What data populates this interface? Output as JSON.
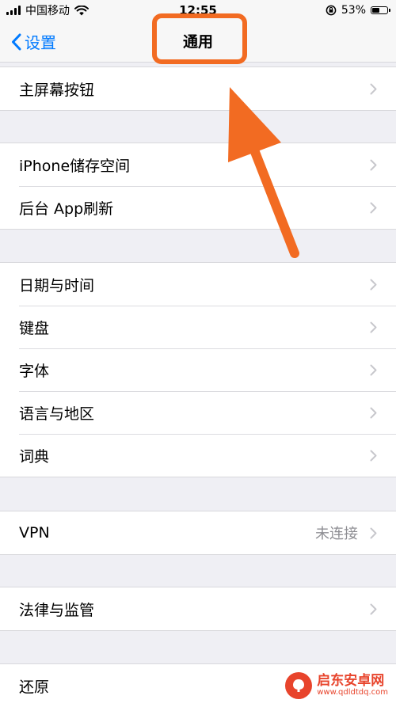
{
  "status_bar": {
    "carrier": "中国移动",
    "time": "12:55",
    "battery_percent": "53%",
    "battery_level": 0.53,
    "icons": [
      "signal-icon",
      "wifi-icon",
      "rotation-lock-icon",
      "battery-icon"
    ]
  },
  "nav": {
    "back_label": "设置",
    "title": "通用"
  },
  "groups": [
    {
      "items": [
        {
          "label": "主屏幕按钮"
        }
      ]
    },
    {
      "items": [
        {
          "label": "iPhone储存空间"
        },
        {
          "label": "后台 App刷新"
        }
      ]
    },
    {
      "items": [
        {
          "label": "日期与时间"
        },
        {
          "label": "键盘"
        },
        {
          "label": "字体"
        },
        {
          "label": "语言与地区"
        },
        {
          "label": "词典"
        }
      ]
    },
    {
      "items": [
        {
          "label": "VPN",
          "value": "未连接"
        }
      ]
    },
    {
      "items": [
        {
          "label": "法律与监管"
        }
      ]
    },
    {
      "items": [
        {
          "label": "还原"
        }
      ]
    }
  ],
  "watermark": {
    "name": "启东安卓网",
    "url": "www.qdldtdq.com"
  },
  "colors": {
    "accent": "#007aff",
    "annotation": "#f26b22",
    "background": "#efeff4",
    "chevron": "#c7c7cc",
    "secondary_text": "#8e8e93"
  }
}
